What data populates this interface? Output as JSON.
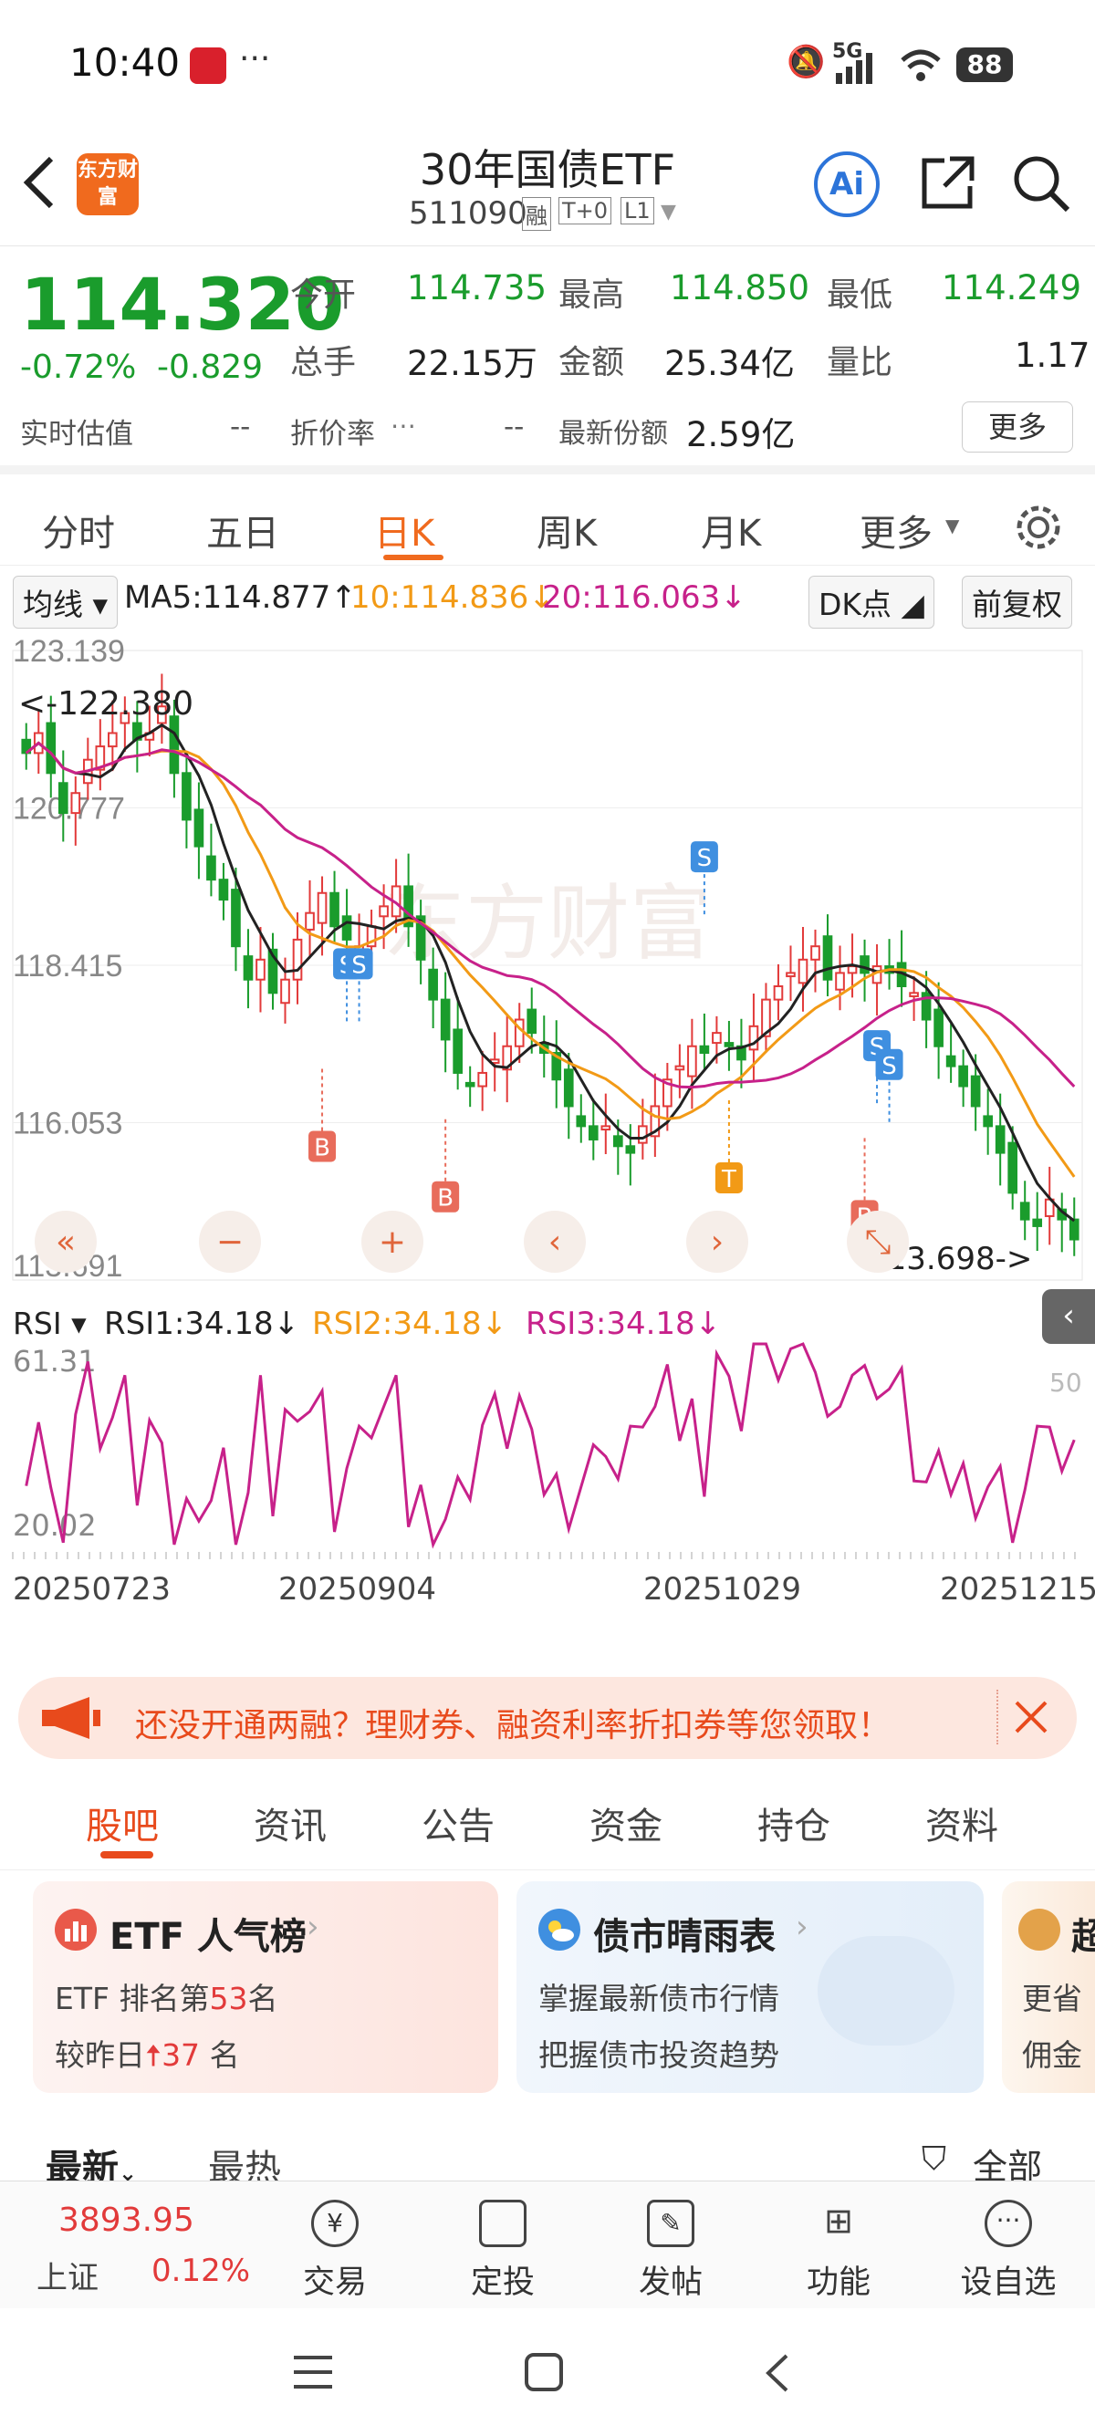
{
  "status_bar": {
    "time": "10:40",
    "more": "···",
    "network": "5G",
    "battery": "88"
  },
  "header": {
    "logo": "东方财富",
    "title": "30年国债ETF",
    "code": "511090",
    "badges": [
      "融",
      "T+0",
      "L1"
    ],
    "ai_label": "Ai"
  },
  "quote": {
    "price": "114.320",
    "change_pct": "-0.72%",
    "change": "-0.829",
    "fields": [
      {
        "label": "今开",
        "value": "114.735"
      },
      {
        "label": "最高",
        "value": "114.850"
      },
      {
        "label": "最低",
        "value": "114.249"
      },
      {
        "label": "总手",
        "value": "22.15万"
      },
      {
        "label": "金额",
        "value": "25.34亿"
      },
      {
        "label": "量比",
        "value": "1.17"
      }
    ],
    "est_label": "实时估值",
    "est_value": "--",
    "discount_label": "折价率",
    "discount_value": "--",
    "shares_label": "最新份额",
    "shares_value": "2.59亿",
    "more_button": "更多"
  },
  "period_tabs": [
    "分时",
    "五日",
    "日K",
    "周K",
    "月K",
    "更多"
  ],
  "active_tab": "日K",
  "indicator": {
    "ma_select": "均线",
    "ma5": "MA5:114.877",
    "ma10": "10:114.836",
    "ma20": "20:116.063",
    "dk_button": "DK点",
    "adjust_button": "前复权"
  },
  "rsi": {
    "select": "RSI",
    "rsi1": "RSI1:34.18",
    "rsi2": "RSI2:34.18",
    "rsi3": "RSI3:34.18",
    "y_max": "61.31",
    "y_min": "20.02",
    "ref_line": "50"
  },
  "chart_data": {
    "type": "candlestick",
    "y_ticks": [
      "123.139",
      "120.777",
      "118.415",
      "116.053",
      "113.691"
    ],
    "ylim": [
      113.691,
      123.139
    ],
    "high_annotation": "<-122.380",
    "low_annotation": "113.698->",
    "x_labels": [
      "20250723",
      "20250904",
      "20251029",
      "20251215"
    ],
    "close_series": [
      121.6,
      121.9,
      121.3,
      120.7,
      121.0,
      121.5,
      121.7,
      121.9,
      122.2,
      121.8,
      121.9,
      122.3,
      121.3,
      120.6,
      120.2,
      119.7,
      119.4,
      118.7,
      118.2,
      118.5,
      118.0,
      118.2,
      118.8,
      119.2,
      119.5,
      119.0,
      118.8,
      118.7,
      119.0,
      119.3,
      119.6,
      119.0,
      118.5,
      117.9,
      117.3,
      116.8,
      116.6,
      116.8,
      117.0,
      117.2,
      117.6,
      117.4,
      117.1,
      116.7,
      116.3,
      116.0,
      115.8,
      116.0,
      115.7,
      115.6,
      116.0,
      116.3,
      116.7,
      116.9,
      117.2,
      117.1,
      117.4,
      117.2,
      117.0,
      117.5,
      117.9,
      118.1,
      118.3,
      118.5,
      118.7,
      118.2,
      118.3,
      118.4,
      118.3,
      118.4,
      118.3,
      118.1,
      118.0,
      117.6,
      117.2,
      116.9,
      116.6,
      116.3,
      116.0,
      115.6,
      115.0,
      114.6,
      114.5,
      114.9,
      114.6,
      114.3
    ],
    "signals": [
      {
        "label": "S",
        "kind": "sell"
      },
      {
        "label": "S",
        "kind": "sell"
      },
      {
        "label": "B",
        "kind": "buy"
      },
      {
        "label": "B",
        "kind": "buy"
      },
      {
        "label": "S",
        "kind": "sell"
      },
      {
        "label": "T",
        "kind": "t"
      },
      {
        "label": "S",
        "kind": "sell"
      },
      {
        "label": "S",
        "kind": "sell"
      },
      {
        "label": "B",
        "kind": "buy"
      }
    ]
  },
  "chart_controls": [
    "«",
    "−",
    "+",
    "‹",
    "›",
    "⤡"
  ],
  "banner": {
    "text": "还没开通两融？理财券、融资利率折扣券等您领取！"
  },
  "sub_tabs": [
    "股吧",
    "资讯",
    "公告",
    "资金",
    "持仓",
    "资料"
  ],
  "active_sub_tab": "股吧",
  "cards": [
    {
      "title": "ETF 人气榜",
      "line1_prefix": "ETF 排名第",
      "line1_num": "53",
      "line1_suffix": "名",
      "line2_prefix": "较昨日",
      "line2_num": "37",
      "line2_suffix": "名"
    },
    {
      "title": "债市晴雨表",
      "line1": "掌握最新债市行情",
      "line2": "把握债市投资趋势"
    },
    {
      "title": "超",
      "line1": "更省",
      "line2": "佣金"
    }
  ],
  "feed": {
    "latest": "最新",
    "hot": "最热",
    "all": "全部"
  },
  "bottom_bar": {
    "index_value": "3893.95",
    "index_name": "上证",
    "index_change": "0.12%",
    "items": [
      "交易",
      "定投",
      "发帖",
      "功能",
      "设自选"
    ]
  },
  "colors": {
    "up": "#e23a3a",
    "down": "#1a9c2c",
    "accent": "#f06a1e",
    "ma10": "#f29a16",
    "ma20": "#c7218a"
  }
}
